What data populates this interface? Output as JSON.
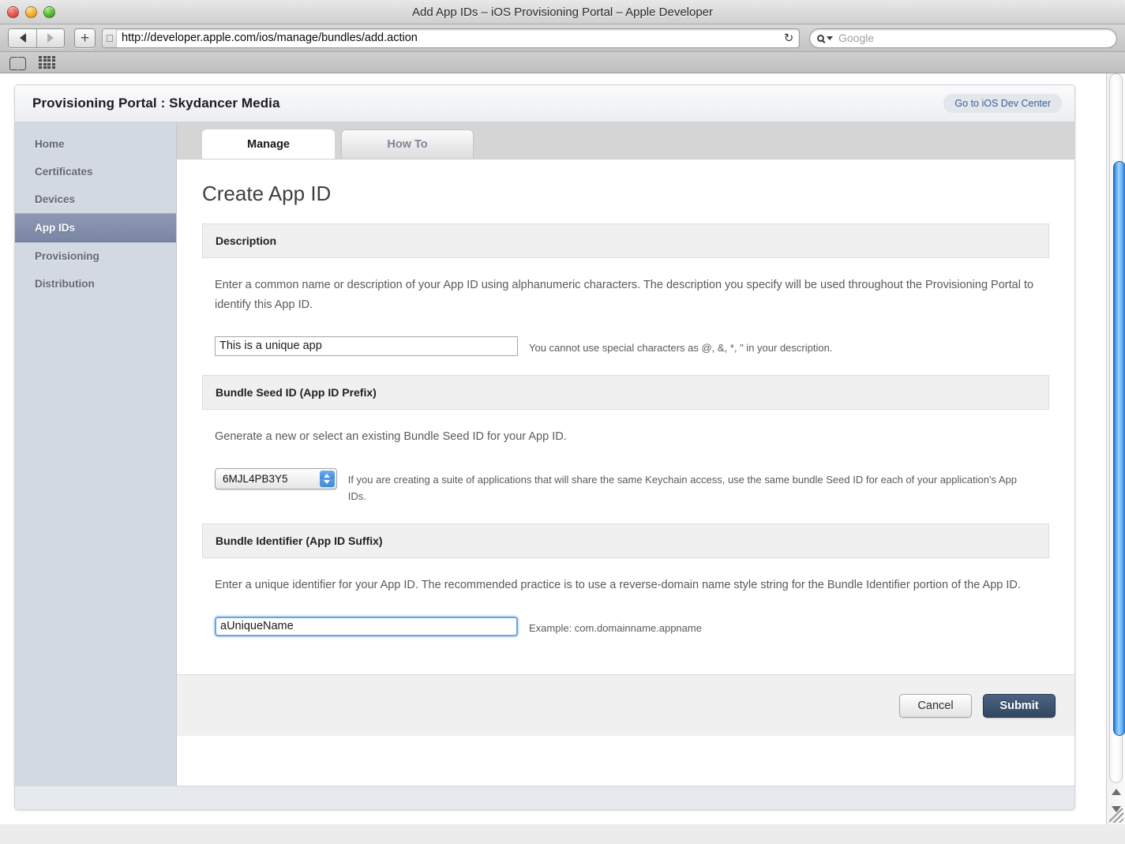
{
  "window": {
    "title": "Add App IDs – iOS Provisioning Portal – Apple Developer",
    "traffic_lights": [
      "close",
      "minimize",
      "zoom"
    ]
  },
  "toolbar": {
    "back_label": "Back",
    "forward_label": "Forward",
    "add_tab_label": "+",
    "url": "http://developer.apple.com/ios/manage/bundles/add.action",
    "reload_glyph": "↻",
    "search_placeholder": "Google",
    "favicon": "apple-logo"
  },
  "bookmarks_bar": {
    "items": [
      {
        "icon": "book-icon",
        "label": "Bookmarks"
      },
      {
        "icon": "grid-icon",
        "label": "Top Sites"
      }
    ]
  },
  "portal": {
    "title": "Provisioning Portal : Skydancer Media",
    "dev_center_link": "Go to iOS Dev Center"
  },
  "sidebar": {
    "items": [
      {
        "label": "Home",
        "active": false
      },
      {
        "label": "Certificates",
        "active": false
      },
      {
        "label": "Devices",
        "active": false
      },
      {
        "label": "App IDs",
        "active": true
      },
      {
        "label": "Provisioning",
        "active": false
      },
      {
        "label": "Distribution",
        "active": false
      }
    ]
  },
  "tabs": [
    {
      "label": "Manage",
      "active": true
    },
    {
      "label": "How To",
      "active": false
    }
  ],
  "main": {
    "heading": "Create App ID",
    "sections": [
      {
        "id": "description",
        "header": "Description",
        "body_text": "Enter a common name or description of your App ID using alphanumeric characters. The description you specify will be used throughout the Provisioning Portal to identify this App ID.",
        "input_value": "This is a unique app",
        "input_placeholder": "",
        "hint": "You cannot use special characters as @, &, *, \" in your description."
      },
      {
        "id": "bundle-seed-id",
        "header": "Bundle Seed ID (App ID Prefix)",
        "body_text": "Generate a new or select an existing Bundle Seed ID for your App ID.",
        "select_value": "6MJL4PB3Y5",
        "hint": "If you are creating a suite of applications that will share the same Keychain access, use the same bundle Seed ID for each of your application's App IDs."
      },
      {
        "id": "bundle-identifier",
        "header": "Bundle Identifier (App ID Suffix)",
        "body_text": "Enter a unique identifier for your App ID. The recommended practice is to use a reverse-domain name style string for the Bundle Identifier portion of the App ID.",
        "input_value": "aUniqueName",
        "input_placeholder": "",
        "hint": "Example: com.domainname.appname"
      }
    ],
    "actions": {
      "cancel_label": "Cancel",
      "submit_label": "Submit"
    }
  },
  "colors": {
    "sidebar_bg": "#d3d9e3",
    "sidebar_active": "#7a86a5",
    "submit_button": "#32475f",
    "link": "#3a5f96",
    "scrollbar_thumb": "#5aa9f2",
    "section_header_bg": "#f0f0f0"
  }
}
